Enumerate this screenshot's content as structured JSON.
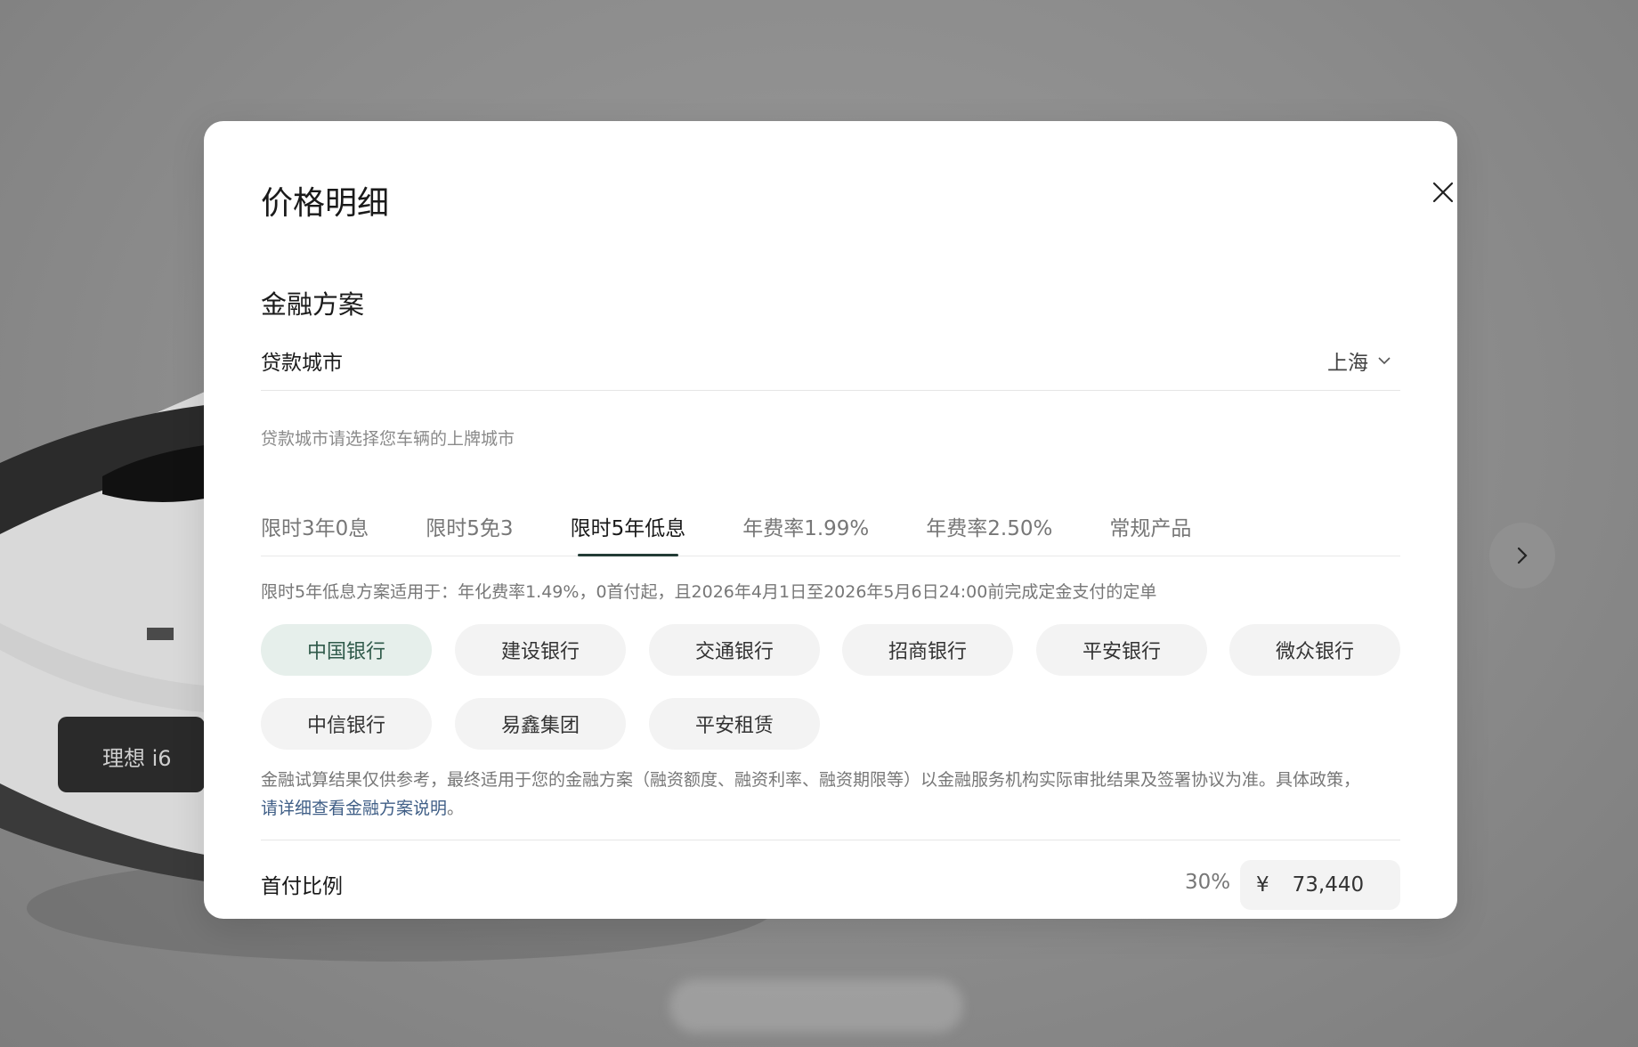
{
  "modal": {
    "title": "价格明细",
    "section_title": "金融方案",
    "city": {
      "label": "贷款城市",
      "value": "上海",
      "hint": "贷款城市请选择您车辆的上牌城市"
    },
    "tabs": [
      {
        "label": "限时3年0息",
        "active": false
      },
      {
        "label": "限时5免3",
        "active": false
      },
      {
        "label": "限时5年低息",
        "active": true
      },
      {
        "label": "年费率1.99%",
        "active": false
      },
      {
        "label": "年费率2.50%",
        "active": false
      },
      {
        "label": "常规产品",
        "active": false
      }
    ],
    "plan_description": "限时5年低息方案适用于：年化费率1.49%，0首付起，且2026年4月1日至2026年5月6日24:00前完成定金支付的定单",
    "banks": [
      {
        "label": "中国银行",
        "active": true
      },
      {
        "label": "建设银行",
        "active": false
      },
      {
        "label": "交通银行",
        "active": false
      },
      {
        "label": "招商银行",
        "active": false
      },
      {
        "label": "平安银行",
        "active": false
      },
      {
        "label": "微众银行",
        "active": false
      },
      {
        "label": "中信银行",
        "active": false
      },
      {
        "label": "易鑫集团",
        "active": false
      },
      {
        "label": "平安租赁",
        "active": false
      }
    ],
    "disclaimer_text": "金融试算结果仅供参考，最终适用于您的金融方案（融资额度、融资利率、融资期限等）以金融服务机构实际审批结果及签署协议为准。具体政策，",
    "disclaimer_link": "请详细查看金融方案说明",
    "disclaimer_end": "。",
    "down_payment": {
      "label": "首付比例",
      "percent": "30%",
      "currency": "¥",
      "amount": "73,440"
    }
  },
  "background": {
    "car_badge": "理想 i6"
  },
  "colors": {
    "accent": "#233c36",
    "active_chip_bg": "#e6efeb",
    "active_chip_text": "#2f5a4a",
    "link": "#3f5e86"
  },
  "icons": {
    "close": "close-icon",
    "chevron": "chevron-down-icon",
    "next": "chevron-right-icon"
  }
}
